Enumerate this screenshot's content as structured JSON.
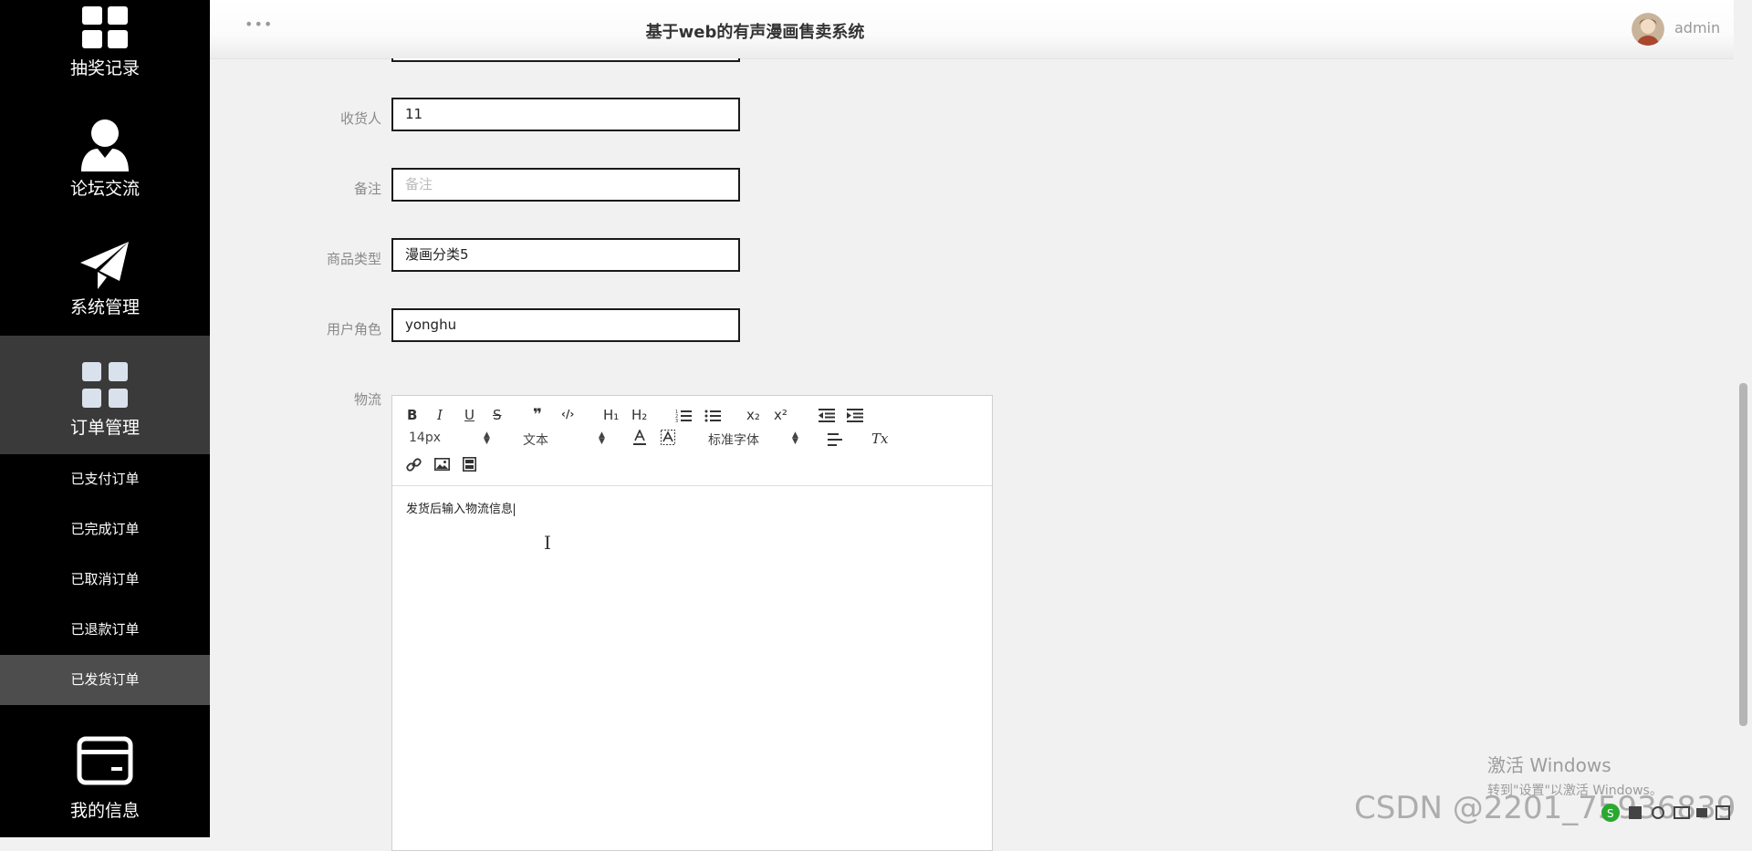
{
  "header": {
    "title": "基于web的有声漫画售卖系统",
    "username": "admin"
  },
  "sidebar": {
    "items": [
      {
        "label": "抽奖记录",
        "icon": "grid-icon"
      },
      {
        "label": "论坛交流",
        "icon": "user-icon"
      },
      {
        "label": "系统管理",
        "icon": "paper-plane-icon"
      },
      {
        "label": "订单管理",
        "icon": "grid-icon",
        "active": true
      },
      {
        "label": "我的信息",
        "icon": "card-icon"
      }
    ],
    "sub_items": [
      {
        "label": "已支付订单"
      },
      {
        "label": "已完成订单"
      },
      {
        "label": "已取消订单"
      },
      {
        "label": "已退款订单"
      },
      {
        "label": "已发货订单",
        "active": true
      }
    ]
  },
  "form": {
    "receiver": {
      "label": "收货人",
      "value": "11"
    },
    "remark": {
      "label": "备注",
      "placeholder": "备注"
    },
    "product_type": {
      "label": "商品类型",
      "value": "漫画分类5"
    },
    "user_role": {
      "label": "用户角色",
      "value": "yonghu"
    },
    "logistics": {
      "label": "物流"
    }
  },
  "editor": {
    "font_size": "14px",
    "block_type": "文本",
    "font_family": "标准字体",
    "content": "发货后输入物流信息",
    "toolbar": {
      "bold": "B",
      "italic": "I",
      "underline": "U",
      "strike": "S",
      "quote": "❞",
      "code": "‹/›",
      "h1": "H₁",
      "h2": "H₂",
      "subscript": "x₂",
      "superscript": "x²",
      "clear_format": "Tx"
    }
  },
  "watermark": {
    "windows_line1": "激活 Windows",
    "windows_line2": "转到\"设置\"以激活 Windows。",
    "csdn": "CSDN @2201_75936839"
  },
  "colors": {
    "sidebar_bg": "#000000",
    "active_bg": "#3a3a3a",
    "sub_active_bg": "#4d4d4d",
    "page_bg": "#f1f1f1"
  }
}
